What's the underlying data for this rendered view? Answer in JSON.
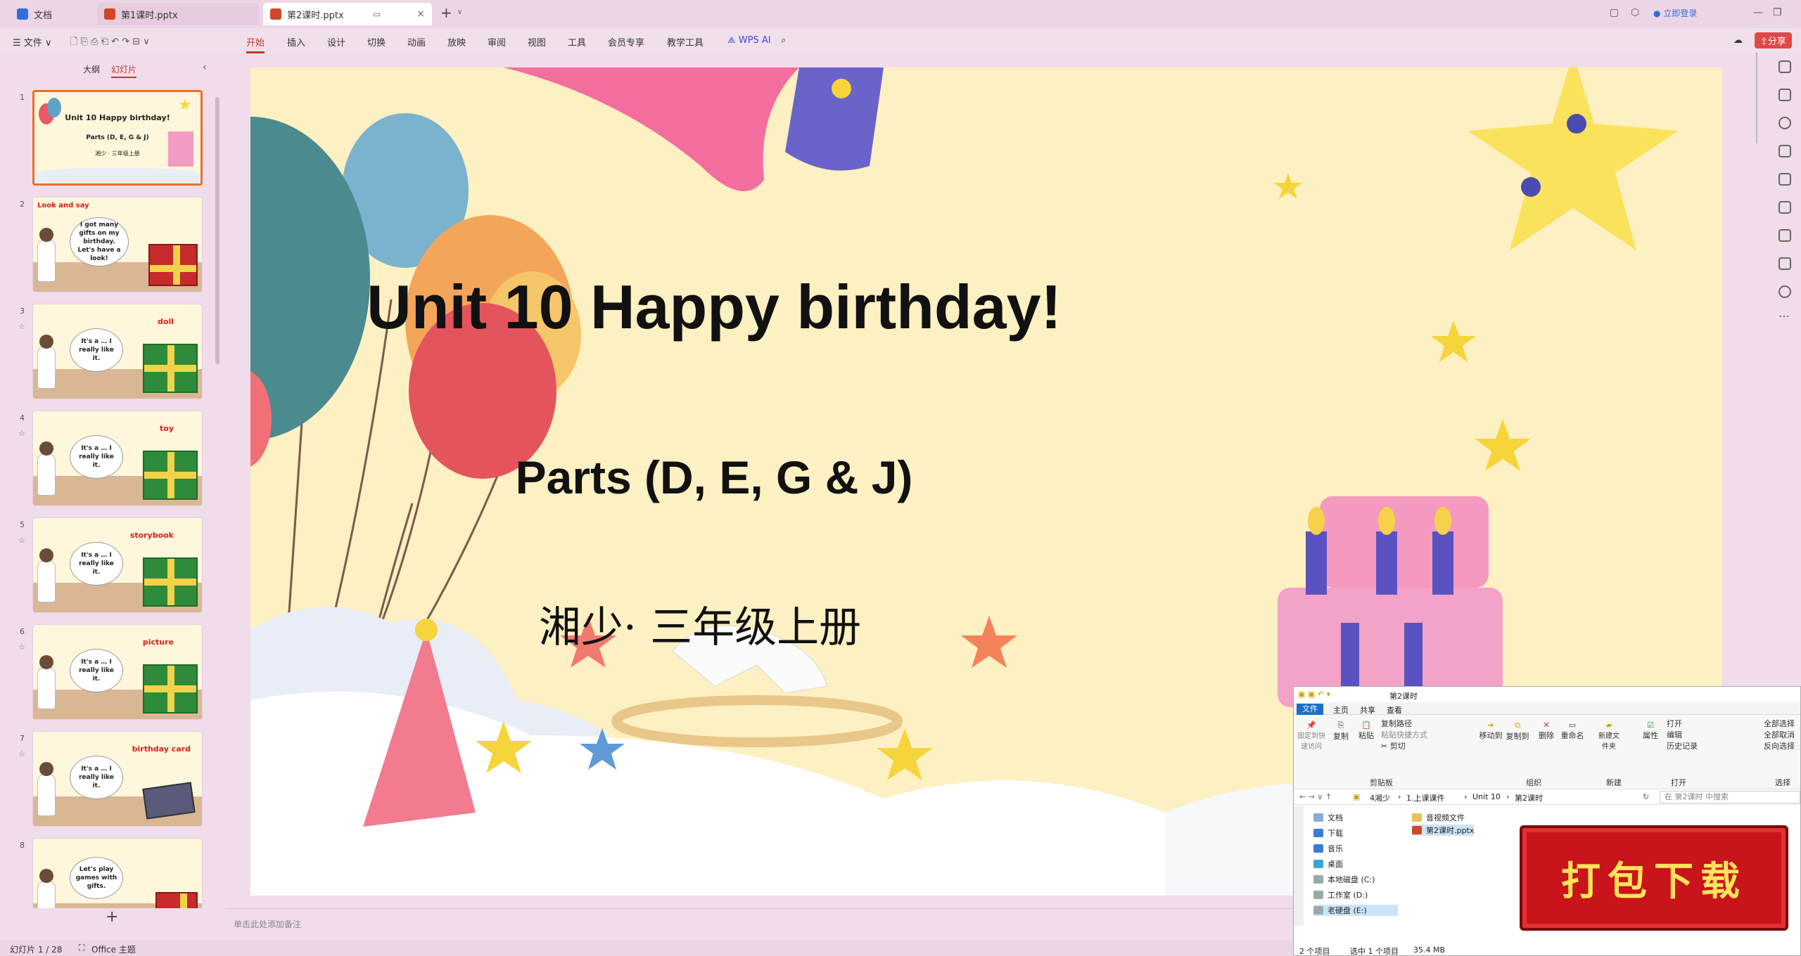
{
  "tabs": [
    {
      "label": "文档",
      "color": "#2f6fe0"
    },
    {
      "label": "第1课时.pptx",
      "color": "#d24726"
    },
    {
      "label": "第2课时.pptx",
      "color": "#d24726"
    }
  ],
  "topright": {
    "login": "立即登录"
  },
  "ribbon": {
    "file": "文件",
    "items": [
      "开始",
      "插入",
      "设计",
      "切换",
      "动画",
      "放映",
      "审阅",
      "视图",
      "工具",
      "会员专享",
      "教学工具"
    ],
    "wps_ai": "WPS AI",
    "share": "分享"
  },
  "leftpanel": {
    "tab_outline": "大纲",
    "tab_slides": "幻灯片",
    "slides": [
      {
        "num": "1",
        "title": "Unit 10 Happy birthday!",
        "sub": "Parts (D, E, G & J)",
        "sub2": "湘少 · 三年级上册"
      },
      {
        "num": "2",
        "heading": "Look and say",
        "bubble": "I got many gifts on my birthday. Let's have a look!"
      },
      {
        "num": "3",
        "bubble": "It's a … I really like it.",
        "word": "doll"
      },
      {
        "num": "4",
        "bubble": "It's a … I really like it.",
        "word": "toy"
      },
      {
        "num": "5",
        "bubble": "It's a … I really like it.",
        "word": "storybook"
      },
      {
        "num": "6",
        "bubble": "It's a … I really like it.",
        "word": "picture"
      },
      {
        "num": "7",
        "bubble": "It's a … I really like it.",
        "word": "birthday card"
      },
      {
        "num": "8",
        "bubble": "Let's play games with gifts."
      }
    ],
    "add": "+"
  },
  "slide": {
    "title": "Unit 10 Happy birthday!",
    "subtitle": "Parts (D, E, G & J)",
    "publisher": "湘少· 三年级上册"
  },
  "notes_placeholder": "单击此处添加备注",
  "status": {
    "slide_count": "幻灯片 1 / 28",
    "theme": "Office 主题"
  },
  "explorer": {
    "title": "第2课时",
    "tabs": [
      "文件",
      "主页",
      "共享",
      "查看"
    ],
    "tools": {
      "pin": "固定到快速访问",
      "copy": "复制",
      "paste": "粘贴",
      "copy_path": "复制路径",
      "paste_shortcut": "粘贴快捷方式",
      "cut": "剪切",
      "clipboard": "剪贴板",
      "move_to": "移动到",
      "copy_to": "复制到",
      "delete": "删除",
      "rename": "重命名",
      "organize": "组织",
      "new_folder": "新建文件夹",
      "new": "新建",
      "properties": "属性",
      "open": "打开",
      "edit": "编辑",
      "history": "历史记录",
      "open_group": "打开",
      "select_all": "全部选择",
      "select_none": "全部取消",
      "invert": "反向选择",
      "select": "选择"
    },
    "path": [
      "4湘少",
      "1.上课课件",
      "Unit 10",
      "第2课时"
    ],
    "search_placeholder": "在 第2课时 中搜索",
    "nav": [
      "文档",
      "下载",
      "音乐",
      "桌面",
      "本地磁盘 (C:)",
      "工作室 (D:)",
      "老硬盘 (E:)"
    ],
    "files": [
      "音视频文件",
      "第2课时.pptx"
    ],
    "status": {
      "count": "2 个项目",
      "selected": "选中 1 个项目",
      "size": "35.4 MB"
    }
  },
  "download_badge": "打包下载"
}
